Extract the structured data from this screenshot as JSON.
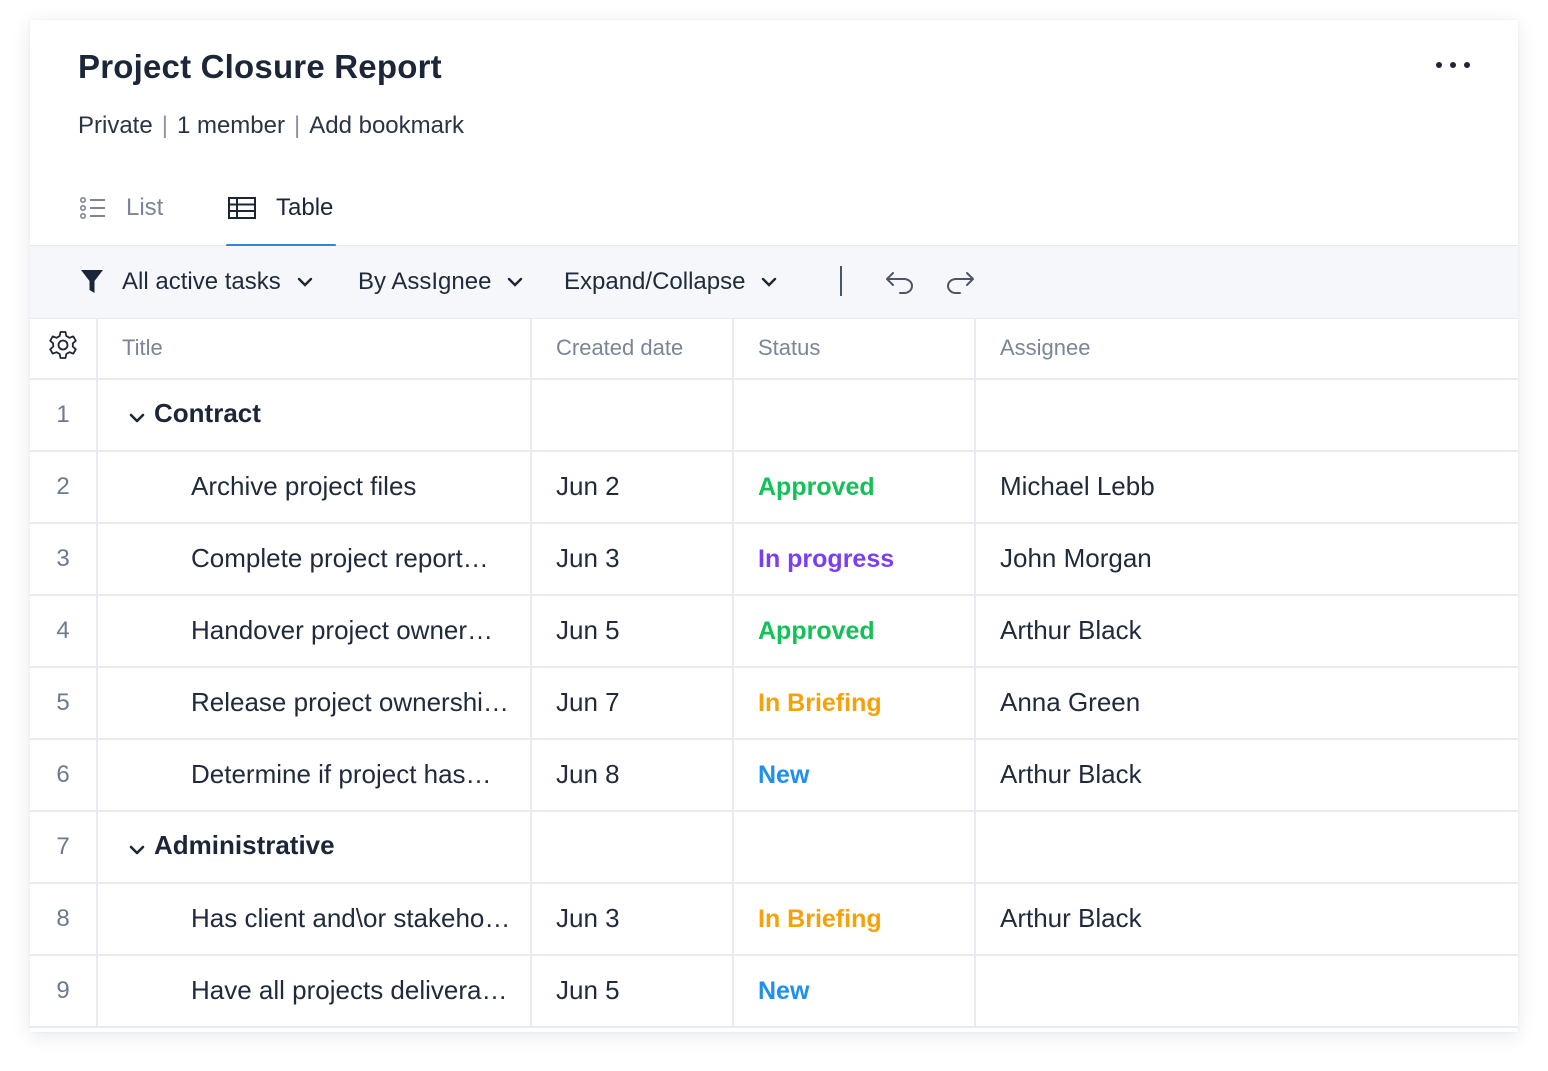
{
  "header": {
    "title": "Project Closure Report",
    "visibility": "Private",
    "members": "1 member",
    "bookmark": "Add bookmark",
    "more_icon": "more-horizontal-icon"
  },
  "tabs": [
    {
      "label": "List",
      "icon": "list-icon",
      "active": false
    },
    {
      "label": "Table",
      "icon": "table-icon",
      "active": true
    }
  ],
  "toolbar": {
    "filter_label": "All active tasks",
    "group_label": "By AssIgnee",
    "expand_label": "Expand/Collapse"
  },
  "columns": {
    "title": "Title",
    "created": "Created date",
    "status": "Status",
    "assignee": "Assignee"
  },
  "colors": {
    "accent": "#2e86de",
    "approved": "#12c157",
    "in_progress": "#7a3ff2",
    "in_briefing": "#f5a10a",
    "new": "#1f8ff0"
  },
  "rows": [
    {
      "num": "1",
      "group": true,
      "title": "Contract"
    },
    {
      "num": "2",
      "title": "Archive project files",
      "created": "Jun 2",
      "status": "Approved",
      "status_color": "#12c157",
      "assignee": "Michael Lebb"
    },
    {
      "num": "3",
      "title": "Complete project report…",
      "created": "Jun 3",
      "status": "In progress",
      "status_color": "#7a3ff2",
      "assignee": "John Morgan"
    },
    {
      "num": "4",
      "title": "Handover project owner…",
      "created": "Jun 5",
      "status": "Approved",
      "status_color": "#12c157",
      "assignee": "Arthur Black"
    },
    {
      "num": "5",
      "title": "Release project ownershi…",
      "created": "Jun 7",
      "status": "In Briefing",
      "status_color": "#f5a10a",
      "assignee": "Anna Green"
    },
    {
      "num": "6",
      "title": "Determine if project has…",
      "created": "Jun 8",
      "status": "New",
      "status_color": "#1f8ff0",
      "assignee": "Arthur Black"
    },
    {
      "num": "7",
      "group": true,
      "title": "Administrative"
    },
    {
      "num": "8",
      "title": "Has client and\\or stakeho…",
      "created": "Jun 3",
      "status": "In Briefing",
      "status_color": "#f5a10a",
      "assignee": "Arthur Black"
    },
    {
      "num": "9",
      "title": "Have all projects delivera…",
      "created": "Jun 5",
      "status": "New",
      "status_color": "#1f8ff0",
      "assignee": ""
    }
  ]
}
